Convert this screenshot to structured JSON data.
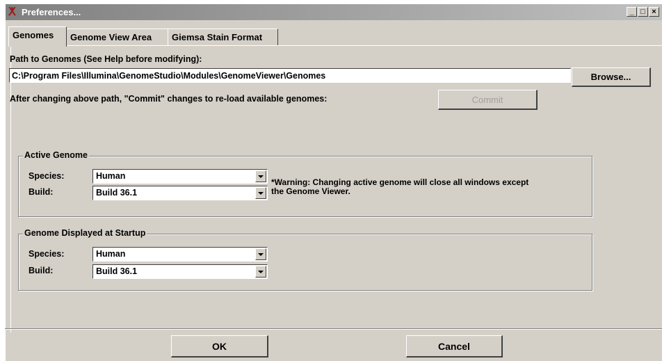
{
  "window": {
    "title": "Preferences...",
    "icon": "genome-app-icon",
    "controls": [
      "_",
      "□",
      "×"
    ]
  },
  "tabs": [
    {
      "label": "Genomes",
      "active": true
    },
    {
      "label": "Genome View Area",
      "active": false
    },
    {
      "label": "Giemsa Stain Format",
      "active": false
    }
  ],
  "genomes": {
    "path_label": "Path to Genomes (See Help before modifying):",
    "path_value": "C:\\Program Files\\Illumina\\GenomeStudio\\Modules\\GenomeViewer\\Genomes",
    "browse_label": "Browse...",
    "commit_hint": "After changing above path, \"Commit\" changes to re-load available genomes:",
    "commit_label": "Commit",
    "commit_enabled": false
  },
  "active_genome": {
    "title": "Active Genome",
    "species_label": "Species:",
    "species_value": "Human",
    "build_label": "Build:",
    "build_value": "Build 36.1",
    "warning_line1": "*Warning: Changing active genome will close all windows except",
    "warning_line2": "the Genome Viewer."
  },
  "startup_genome": {
    "title": "Genome Displayed at Startup",
    "species_label": "Species:",
    "species_value": "Human",
    "build_label": "Build:",
    "build_value": "Build 36.1"
  },
  "footer": {
    "ok_label": "OK",
    "cancel_label": "Cancel"
  },
  "colors": {
    "face": "#d4d0c8",
    "title_gradient_start": "#808080",
    "title_gradient_end": "#c0c0c0",
    "disabled_text": "#a0a0a0"
  }
}
